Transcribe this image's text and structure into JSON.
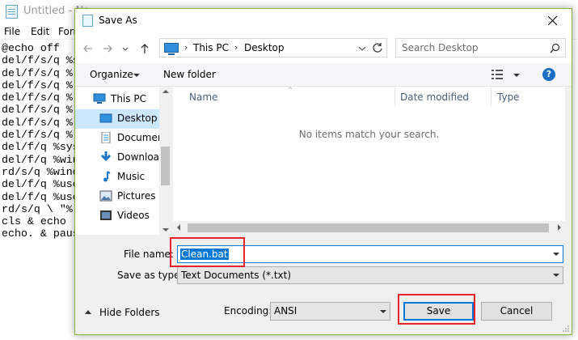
{
  "notepad": {
    "title": "Untitled - No",
    "menu": [
      "File",
      "Edit",
      "Forr"
    ],
    "lines": [
      "@echo off",
      "del/f/s/q %s",
      "del/f/s/q %",
      "del/f/s/q %",
      "del/f/s/q %",
      "del/f/s/q %",
      "del/f/s/q %",
      "del/f/s/q %",
      "del/f/q %sys",
      "del/f/q %win",
      "rd/s/q %wind",
      "del/f/q %use",
      "del/f/q %use",
      "rd/s/q \\ \"%",
      "cls & echo (",
      "echo. & paus"
    ]
  },
  "dialog": {
    "title": "Save As",
    "accent": "#0078d7",
    "highlight_color": "#e8242b",
    "nav": {
      "back_icon": "arrow-left-icon",
      "forward_icon": "arrow-right-icon",
      "recent_icon": "chevron-down-icon",
      "up_icon": "arrow-up-icon",
      "breadcrumb": [
        "This PC",
        "Desktop"
      ],
      "search_placeholder": "Search Desktop"
    },
    "toolbar": {
      "organize": "Organize",
      "new_folder": "New folder"
    },
    "navpane": {
      "items": [
        {
          "label": "This PC",
          "icon": "computer-icon",
          "selected": false
        },
        {
          "label": "Desktop",
          "icon": "desktop-icon",
          "selected": true
        },
        {
          "label": "Documer",
          "icon": "document-icon",
          "selected": false
        },
        {
          "label": "Downloa",
          "icon": "download-icon",
          "selected": false
        },
        {
          "label": "Music",
          "icon": "music-icon",
          "selected": false
        },
        {
          "label": "Pictures",
          "icon": "pictures-icon",
          "selected": false
        },
        {
          "label": "Videos",
          "icon": "videos-icon",
          "selected": false
        }
      ]
    },
    "filelist": {
      "columns": [
        "Name",
        "Date modified",
        "Type"
      ],
      "empty_message": "No items match your search."
    },
    "form": {
      "file_name_label": "File name:",
      "file_name_value": "Clean.bat",
      "save_type_label": "Save as type:",
      "save_type_value": "Text Documents (*.txt)"
    },
    "footer": {
      "hide_folders": "Hide Folders",
      "encoding_label": "Encoding:",
      "encoding_value": "ANSI",
      "save": "Save",
      "cancel": "Cancel"
    }
  }
}
